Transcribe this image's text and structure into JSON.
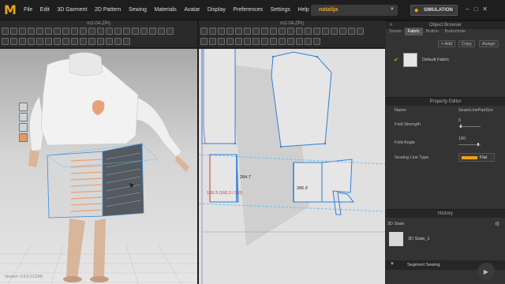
{
  "app": {
    "logo": "M",
    "menus": [
      "File",
      "Edit",
      "3D Garment",
      "2D Pattern",
      "Sewing",
      "Materials",
      "Avatar",
      "Display",
      "Preferences",
      "Settings",
      "Help"
    ],
    "user": "natalija",
    "simulation_label": "SIMULATION",
    "window_controls": [
      "–",
      "□",
      "✕"
    ]
  },
  "viewport3d": {
    "title": "m2-04.ZPrj",
    "status": "Version: 0.0.0 (r1234)"
  },
  "viewport2d": {
    "title": "m2-04.ZPrj",
    "measure_red": "160.3 (160.3 / 0.0)",
    "measure_a": "284.7",
    "measure_b": "286.9"
  },
  "object_browser": {
    "title": "Object Browser",
    "tabs": [
      "Scene",
      "Fabric",
      "Button",
      "Buttonhole"
    ],
    "active_tab": "Fabric",
    "add_label": "+ Add",
    "copy_label": "Copy",
    "assign_label": "Assign",
    "fabric_name": "Default Fabric"
  },
  "property_editor": {
    "title": "Property Editor",
    "name_label": "Name",
    "name_value": "SeamLinePairGro",
    "fold_strength_label": "Fold Strength",
    "fold_strength_value": "5",
    "fold_angle_label": "Fold Angle",
    "fold_angle_value": "180",
    "sewing_line_type_label": "Sewing Line Type",
    "sewing_line_type_value": "Flat"
  },
  "history": {
    "title": "History",
    "state_label": "3D State",
    "state_item": "3D State_1",
    "segment_label": "Segment Sewing"
  },
  "colors": {
    "accent": "#e8a21c",
    "seam_blue": "#2f7fd6",
    "seam_red": "#d63030"
  }
}
